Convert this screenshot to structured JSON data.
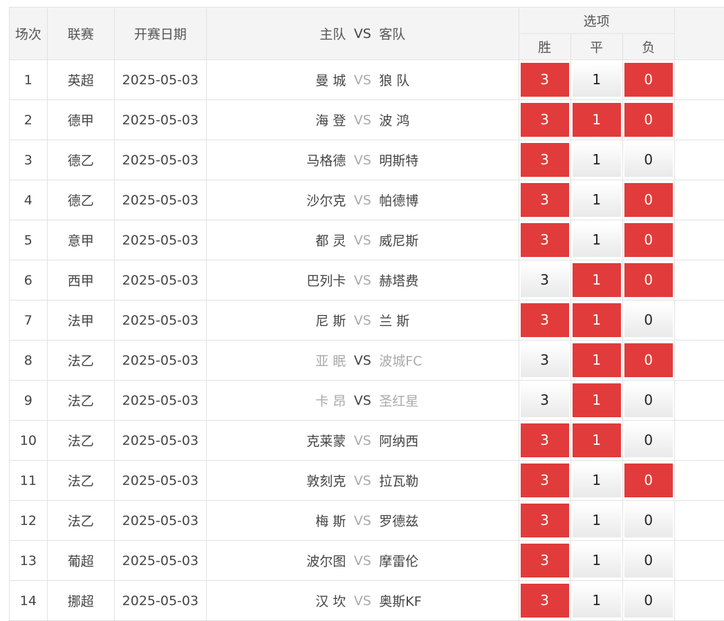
{
  "header": {
    "num": "场次",
    "league": "联赛",
    "date": "开赛日期",
    "home": "主队",
    "vs": "VS",
    "away": "客队",
    "options": "选项",
    "win": "胜",
    "draw": "平",
    "lose": "负"
  },
  "option_values": {
    "win": "3",
    "draw": "1",
    "lose": "0"
  },
  "colors": {
    "selected": "#e23b3b"
  },
  "rows": [
    {
      "num": "1",
      "league": "英超",
      "date": "2025-05-03",
      "home": "曼 城",
      "away": "狼 队",
      "win": true,
      "draw": false,
      "lose": true,
      "dim": false
    },
    {
      "num": "2",
      "league": "德甲",
      "date": "2025-05-03",
      "home": "海 登",
      "away": "波 鸿",
      "win": true,
      "draw": true,
      "lose": true,
      "dim": false
    },
    {
      "num": "3",
      "league": "德乙",
      "date": "2025-05-03",
      "home": "马格德",
      "away": "明斯特",
      "win": true,
      "draw": false,
      "lose": false,
      "dim": false
    },
    {
      "num": "4",
      "league": "德乙",
      "date": "2025-05-03",
      "home": "沙尔克",
      "away": "帕德博",
      "win": true,
      "draw": false,
      "lose": true,
      "dim": false
    },
    {
      "num": "5",
      "league": "意甲",
      "date": "2025-05-03",
      "home": "都 灵",
      "away": "威尼斯",
      "win": true,
      "draw": false,
      "lose": true,
      "dim": false
    },
    {
      "num": "6",
      "league": "西甲",
      "date": "2025-05-03",
      "home": "巴列卡",
      "away": "赫塔费",
      "win": false,
      "draw": true,
      "lose": true,
      "dim": false
    },
    {
      "num": "7",
      "league": "法甲",
      "date": "2025-05-03",
      "home": "尼 斯",
      "away": "兰 斯",
      "win": true,
      "draw": true,
      "lose": false,
      "dim": false
    },
    {
      "num": "8",
      "league": "法乙",
      "date": "2025-05-03",
      "home": "亚 眠",
      "away": "波城FC",
      "win": false,
      "draw": true,
      "lose": true,
      "dim": true
    },
    {
      "num": "9",
      "league": "法乙",
      "date": "2025-05-03",
      "home": "卡 昂",
      "away": "圣红星",
      "win": false,
      "draw": true,
      "lose": false,
      "dim": true
    },
    {
      "num": "10",
      "league": "法乙",
      "date": "2025-05-03",
      "home": "克莱蒙",
      "away": "阿纳西",
      "win": true,
      "draw": true,
      "lose": false,
      "dim": false
    },
    {
      "num": "11",
      "league": "法乙",
      "date": "2025-05-03",
      "home": "敦刻克",
      "away": "拉瓦勒",
      "win": true,
      "draw": false,
      "lose": true,
      "dim": false
    },
    {
      "num": "12",
      "league": "法乙",
      "date": "2025-05-03",
      "home": "梅 斯",
      "away": "罗德兹",
      "win": true,
      "draw": false,
      "lose": false,
      "dim": false
    },
    {
      "num": "13",
      "league": "葡超",
      "date": "2025-05-03",
      "home": "波尔图",
      "away": "摩雷伦",
      "win": true,
      "draw": false,
      "lose": false,
      "dim": false
    },
    {
      "num": "14",
      "league": "挪超",
      "date": "2025-05-03",
      "home": "汉 坎",
      "away": "奥斯KF",
      "win": true,
      "draw": false,
      "lose": false,
      "dim": false
    }
  ]
}
